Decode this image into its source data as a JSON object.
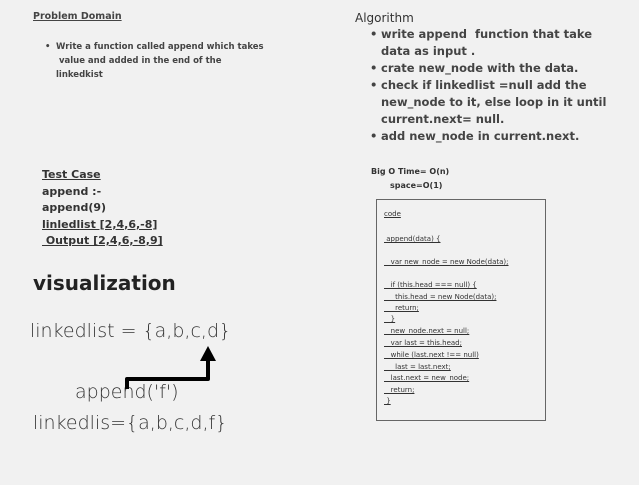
{
  "problem_domain": {
    "title": "Problem Domain",
    "bullet": "•",
    "lines": [
      "Write a function called append which takes",
      " value and added in the end of the",
      "linkedkist"
    ]
  },
  "algorithm": {
    "title": "Algorithm",
    "bullet": "•",
    "items": [
      [
        "write append  function that take",
        "data as input ."
      ],
      [
        "crate new_node with the data."
      ],
      [
        "check if linkedlist =null add the",
        "new_node to it, else loop in it until",
        "current.next= null."
      ],
      [
        "add new_node in current.next."
      ]
    ]
  },
  "test_case": {
    "title": "Test Case",
    "lines": [
      "append :-",
      "append(9)"
    ],
    "input": "linledlist [2,4,6,-8]",
    "output": " Output [2,4,6,-8,9]"
  },
  "visualization": {
    "title": "visualization",
    "before": "linkedlist = {a,b,c,d}",
    "call": "append('f')",
    "after": "linkedlis={a,b,c,d,f}"
  },
  "big_o": {
    "time": "Big O   Time= O(n)",
    "space": "space=O(1)"
  },
  "code": {
    "title": "code",
    "lines": [
      " append(data) {",
      "   var new_node = new Node(data);",
      "   if (this.head === null) {",
      "     this.head = new Node(data);",
      "     return;",
      "   }",
      "   new_node.next = null;",
      "   var last = this.head;",
      "   while (last.next !== null)",
      "     last = last.next;",
      "   last.next = new_node;",
      "   return;",
      " }"
    ]
  }
}
